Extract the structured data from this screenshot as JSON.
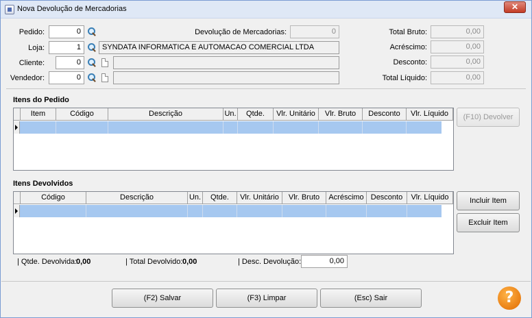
{
  "window": {
    "title": "Nova Devolução de Mercadorias",
    "close_label": "✕"
  },
  "form": {
    "pedido": {
      "label": "Pedido:",
      "value": "0"
    },
    "loja": {
      "label": "Loja:",
      "value": "1",
      "name": "SYNDATA INFORMATICA E AUTOMACAO COMERCIAL LTDA"
    },
    "cliente": {
      "label": "Cliente:",
      "value": "0",
      "name": ""
    },
    "vendedor": {
      "label": "Vendedor:",
      "value": "0",
      "name": ""
    },
    "devolucao": {
      "label": "Devolução de Mercadorias:",
      "value": "0"
    },
    "total_bruto": {
      "label": "Total Bruto:",
      "value": "0,00"
    },
    "acrescimo": {
      "label": "Acréscimo:",
      "value": "0,00"
    },
    "desconto": {
      "label": "Desconto:",
      "value": "0,00"
    },
    "total_liquido": {
      "label": "Total Líquido:",
      "value": "0,00"
    }
  },
  "itens_pedido": {
    "title": "Itens do Pedido",
    "columns": [
      "Item",
      "Código",
      "Descrição",
      "Un.",
      "Qtde.",
      "Vlr. Unitário",
      "Vlr. Bruto",
      "Desconto",
      "Vlr. Líquido"
    ],
    "devolver_button": "(F10) Devolver"
  },
  "itens_devolvidos": {
    "title": "Itens Devolvidos",
    "columns": [
      "Código",
      "Descrição",
      "Un.",
      "Qtde.",
      "Vlr. Unitário",
      "Vlr. Bruto",
      "Acréscimo",
      "Desconto",
      "Vlr. Líquido"
    ],
    "incluir_button": "Incluir Item",
    "excluir_button": "Excluir Item"
  },
  "summary": {
    "qtde_label": "| Qtde. Devolvida:",
    "qtde_value": "0,00",
    "total_label": "| Total Devolvido:",
    "total_value": "0,00",
    "desc_label": "| Desc. Devolução:",
    "desc_value": "0,00"
  },
  "footer": {
    "salvar": "(F2) Salvar",
    "limpar": "(F3) Limpar",
    "sair": "(Esc) Sair",
    "help": "?"
  }
}
